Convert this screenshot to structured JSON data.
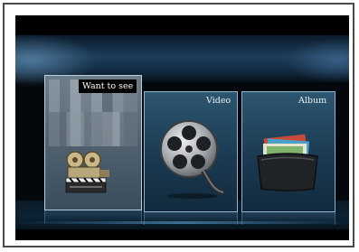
{
  "menu": {
    "items": [
      {
        "label": "Want to see",
        "icon": "clapperboard-projector-icon",
        "selected": true
      },
      {
        "label": "Video",
        "icon": "film-reel-icon",
        "selected": false
      },
      {
        "label": "Album",
        "icon": "photo-album-icon",
        "selected": false
      }
    ]
  },
  "colors": {
    "panel_border": "#8fb3cf",
    "selected_border": "#b8cfdf",
    "label_bg": "#000000",
    "label_text": "#ffffff"
  }
}
